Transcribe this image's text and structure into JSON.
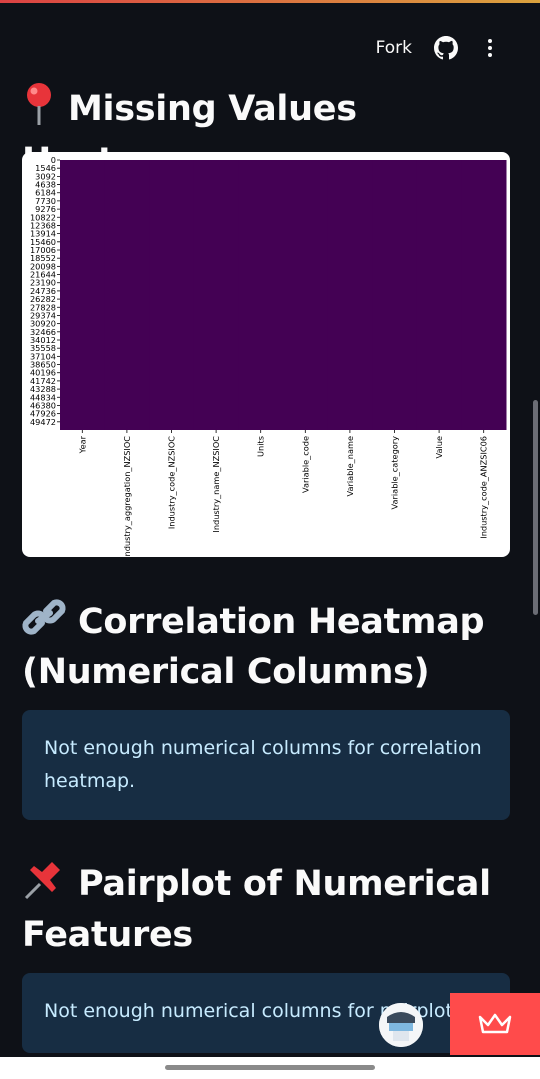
{
  "toolbar": {
    "fork_label": "Fork",
    "github_icon": "github-icon",
    "menu_icon": "kebab-menu-icon"
  },
  "sections": {
    "missing": {
      "emoji": "📍",
      "title": "Missing Values Heatmap"
    },
    "correlation": {
      "emoji": "🔗",
      "title": "Correlation Heatmap (Numerical Columns)",
      "info": "Not enough numerical columns for correlation heatmap."
    },
    "pairplot": {
      "emoji": "📌",
      "title": "Pairplot of Numerical Features",
      "info": "Not enough numerical columns for pairplot."
    }
  },
  "colors": {
    "background": "#0e1117",
    "info_bg": "#172d43",
    "info_text": "#c7ebff",
    "heatmap_fill": "#440154",
    "fab": "#ff4b4b"
  },
  "chart_data": {
    "type": "heatmap",
    "title": "",
    "xlabel": "",
    "ylabel": "",
    "x_categories": [
      "Year",
      "Industry_aggregation_NZSIOC",
      "Industry_code_NZSIOC",
      "Industry_name_NZSIOC",
      "Units",
      "Variable_code",
      "Variable_name",
      "Variable_category",
      "Value",
      "Industry_code_ANZSIC06"
    ],
    "y_tick_labels": [
      "0",
      "1546",
      "3092",
      "4638",
      "6184",
      "7730",
      "9276",
      "10822",
      "12368",
      "13914",
      "15460",
      "17006",
      "18552",
      "20098",
      "21644",
      "23190",
      "24736",
      "26282",
      "27828",
      "29374",
      "30920",
      "32466",
      "34012",
      "35558",
      "37104",
      "38650",
      "40196",
      "41742",
      "43288",
      "44834",
      "46380",
      "47926",
      "49472"
    ],
    "cell_value": 0,
    "grid": false,
    "colorbar": false
  }
}
